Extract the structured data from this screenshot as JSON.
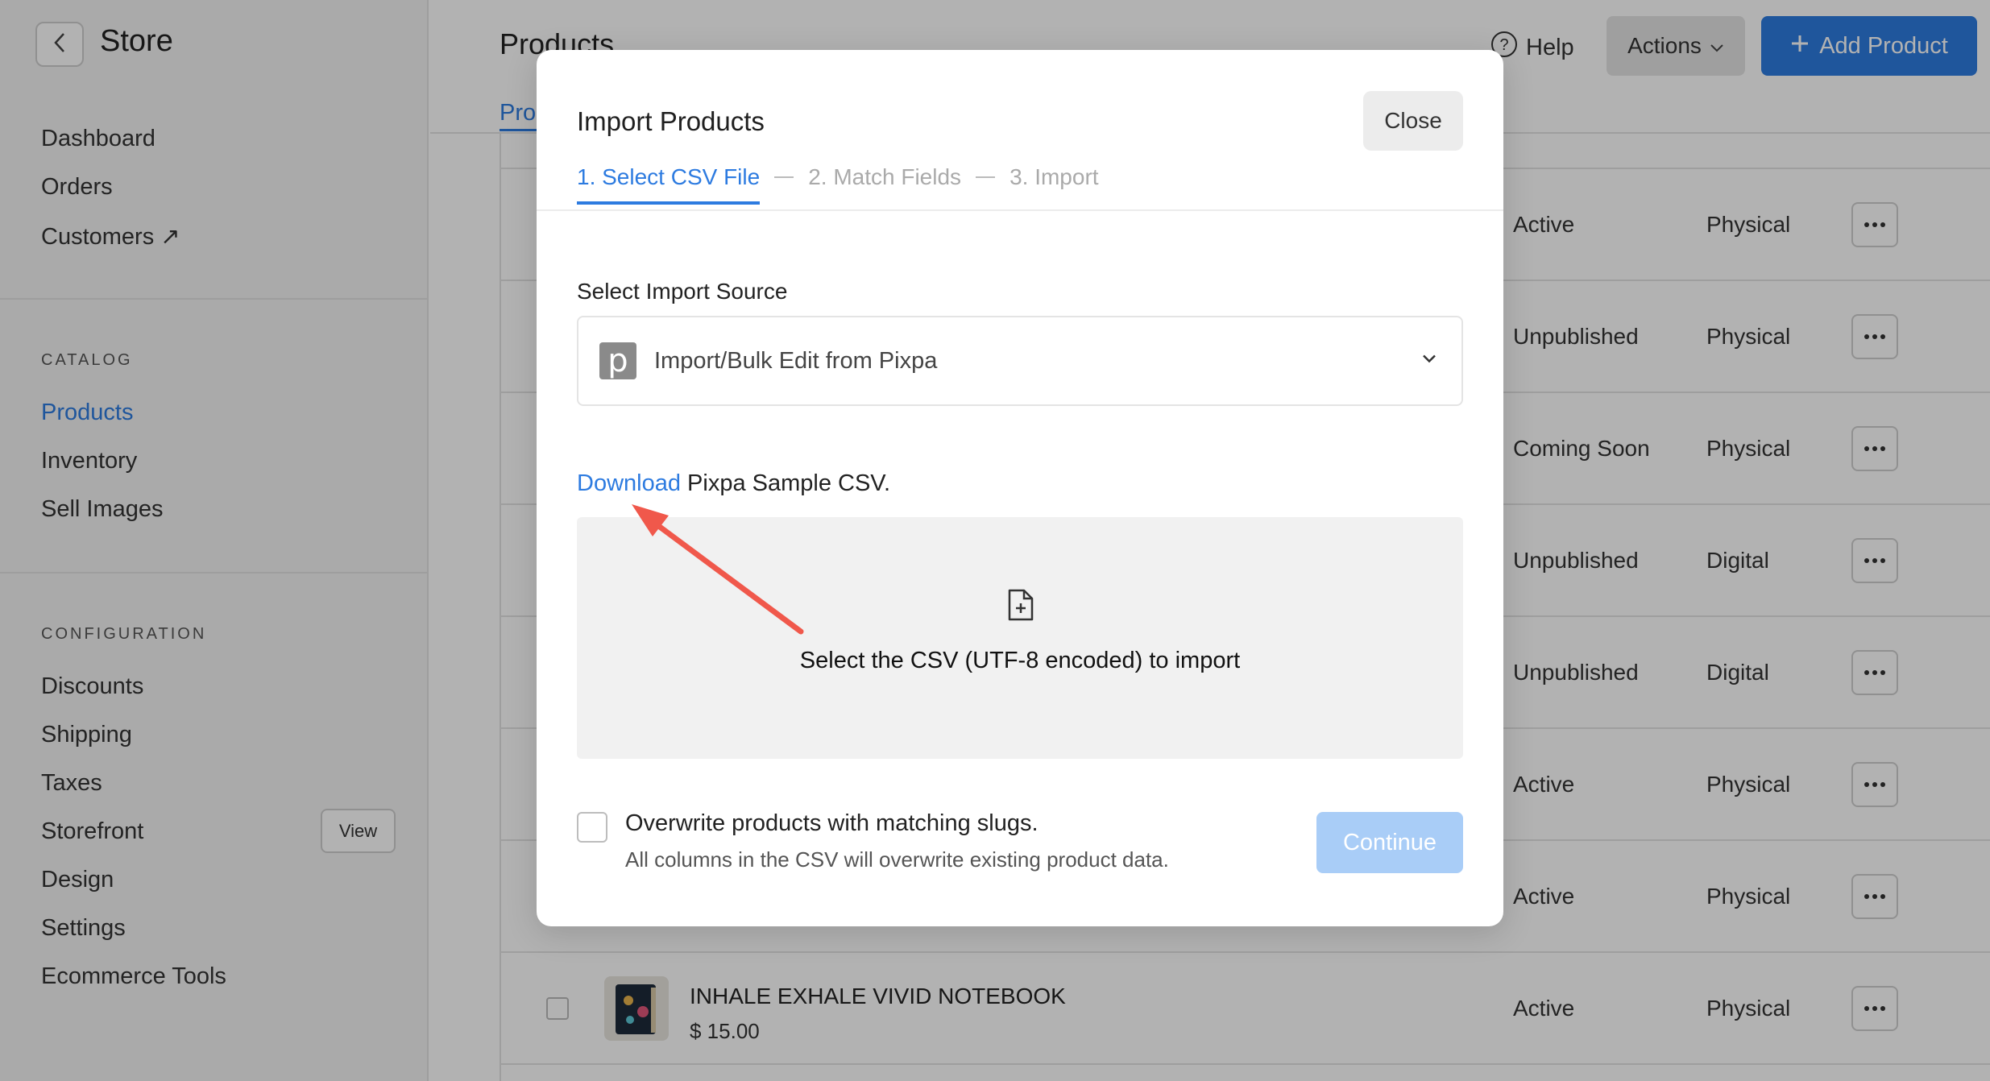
{
  "sidebar": {
    "title": "Store",
    "items_top": [
      "Dashboard",
      "Orders",
      "Customers ↗"
    ],
    "catalog_heading": "CATALOG",
    "catalog_items": [
      "Products",
      "Inventory",
      "Sell Images"
    ],
    "config_heading": "CONFIGURATION",
    "config_items": [
      "Discounts",
      "Shipping",
      "Taxes",
      "Storefront",
      "Design",
      "Settings",
      "Ecommerce Tools"
    ],
    "view_label": "View"
  },
  "header": {
    "title": "Products",
    "tab": "Pro",
    "help": "Help",
    "actions": "Actions",
    "add_product": "Add Product"
  },
  "rows": [
    {
      "status": "Active",
      "type": "Physical"
    },
    {
      "status": "Unpublished",
      "type": "Physical"
    },
    {
      "status": "Coming Soon",
      "type": "Physical"
    },
    {
      "status": "Unpublished",
      "type": "Digital"
    },
    {
      "status": "Unpublished",
      "type": "Digital"
    },
    {
      "status": "Active",
      "type": "Physical"
    },
    {
      "status": "Active",
      "type": "Physical"
    },
    {
      "status": "Active",
      "type": "Physical",
      "name": "INHALE EXHALE VIVID NOTEBOOK",
      "price": "$ 15.00"
    }
  ],
  "modal": {
    "title": "Import Products",
    "close": "Close",
    "steps": [
      "1. Select CSV File",
      "2. Match Fields",
      "3. Import"
    ],
    "source_label": "Select Import Source",
    "source_value": "Import/Bulk Edit from Pixpa",
    "source_logo": "p",
    "download_link": "Download",
    "download_rest": " Pixpa Sample CSV.",
    "dropzone_text": "Select the CSV (UTF-8 encoded) to import",
    "overwrite_title": "Overwrite products with matching slugs.",
    "overwrite_sub": "All columns in the CSV will overwrite existing product data.",
    "continue": "Continue"
  },
  "colors": {
    "accent": "#2d7be0",
    "continue_disabled": "#a9cdf7",
    "annotation_arrow": "#f0584b"
  }
}
